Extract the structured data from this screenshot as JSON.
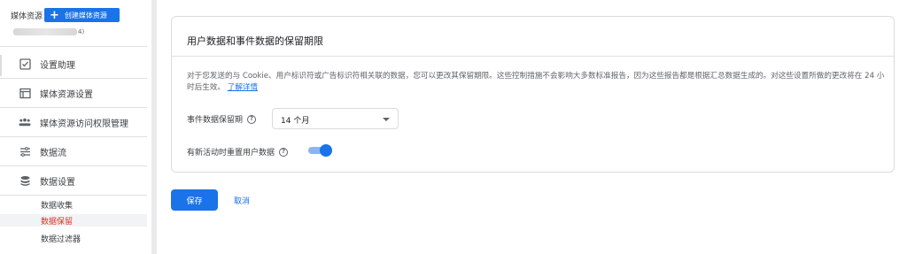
{
  "sidebar": {
    "section_label": "媒体资源",
    "create_button": "创建媒体资源",
    "account_suffix": "4)",
    "items": [
      {
        "label": "设置助理",
        "icon": "checklist-icon"
      },
      {
        "label": "媒体资源设置",
        "icon": "property-settings-icon"
      },
      {
        "label": "媒体资源访问权限管理",
        "icon": "people-icon"
      },
      {
        "label": "数据流",
        "icon": "data-stream-icon"
      },
      {
        "label": "数据设置",
        "icon": "database-icon"
      }
    ],
    "sub_items": [
      {
        "label": "数据收集"
      },
      {
        "label": "数据保留"
      },
      {
        "label": "数据过滤器"
      }
    ]
  },
  "card": {
    "title": "用户数据和事件数据的保留期限",
    "description": "对于您发送的与 Cookie、用户标识符或广告标识符相关联的数据，您可以更改其保留期限。这些控制措施不会影响大多数标准报告，因为这些报告都是根据汇总数据生成的。对这些设置所做的更改将在 24 小时后生效。",
    "learn_more": "了解详情",
    "retention_label": "事件数据保留期",
    "retention_value": "14 个月",
    "reset_label": "有新活动时重置用户数据",
    "reset_enabled": true
  },
  "actions": {
    "save": "保存",
    "cancel": "取消"
  },
  "colors": {
    "accent": "#1a73e8",
    "active_text": "#d93025"
  }
}
